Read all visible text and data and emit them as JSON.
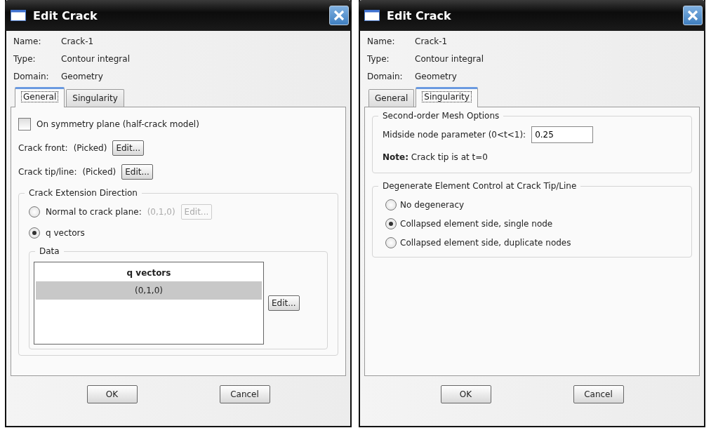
{
  "dialogs": [
    {
      "title": "Edit Crack",
      "kind": "general",
      "info": [
        {
          "label": "Name:",
          "value": "Crack-1"
        },
        {
          "label": "Type:",
          "value": "Contour integral"
        },
        {
          "label": "Domain:",
          "value": "Geometry"
        }
      ],
      "tabs": [
        {
          "label": "General",
          "selected": true
        },
        {
          "label": "Singularity",
          "selected": false
        }
      ],
      "symmetry": {
        "label": "On symmetry plane (half-crack model)",
        "checked": false
      },
      "pick_rows": [
        {
          "label": "Crack front:",
          "value": "(Picked)",
          "button": "Edit..."
        },
        {
          "label": "Crack tip/line:",
          "value": "(Picked)",
          "button": "Edit..."
        }
      ],
      "extension": {
        "title": "Crack Extension Direction",
        "options": [
          {
            "label": "Normal to crack plane:",
            "selected": false,
            "detail": {
              "value": "(0,1,0)",
              "button": "Edit...",
              "disabled": true
            }
          },
          {
            "label": "q vectors",
            "selected": true
          }
        ],
        "data": {
          "title": "Data",
          "column": "q vectors",
          "rows": [
            {
              "value": "(0,1,0)",
              "selected": true
            }
          ],
          "button": "Edit..."
        }
      },
      "buttons": [
        "OK",
        "Cancel"
      ]
    },
    {
      "title": "Edit Crack",
      "kind": "singularity",
      "info": [
        {
          "label": "Name:",
          "value": "Crack-1"
        },
        {
          "label": "Type:",
          "value": "Contour integral"
        },
        {
          "label": "Domain:",
          "value": "Geometry"
        }
      ],
      "tabs": [
        {
          "label": "General",
          "selected": false
        },
        {
          "label": "Singularity",
          "selected": true
        }
      ],
      "mesh": {
        "title": "Second-order Mesh Options",
        "field_label": "Midside node parameter (0<t<1):",
        "field_value": "0.25",
        "note": "**Note:**  Crack tip is at t=0"
      },
      "degenerate": {
        "title": "Degenerate Element Control at Crack Tip/Line",
        "options": [
          {
            "label": "No degeneracy",
            "selected": false
          },
          {
            "label": "Collapsed element side, single node",
            "selected": true
          },
          {
            "label": "Collapsed element side, duplicate nodes",
            "selected": false
          }
        ]
      },
      "buttons": [
        "OK",
        "Cancel"
      ]
    }
  ]
}
